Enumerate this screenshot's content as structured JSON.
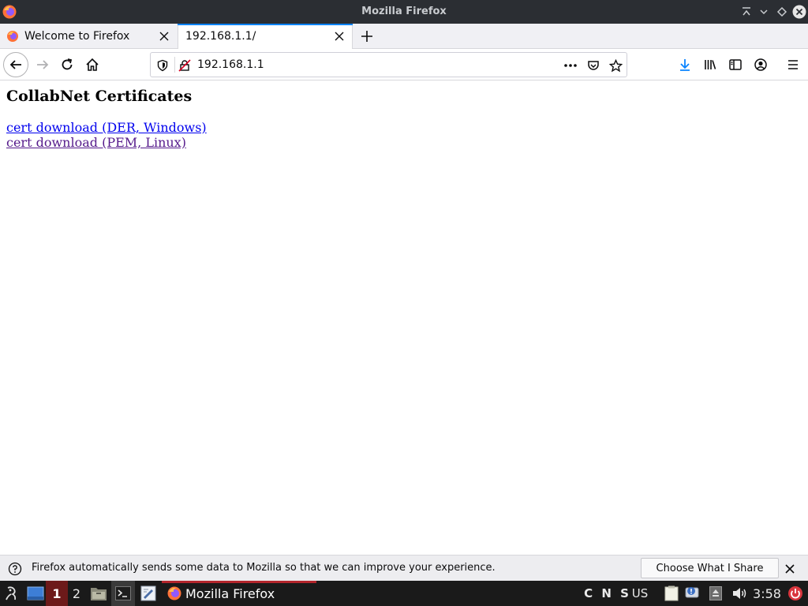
{
  "window": {
    "title": "Mozilla Firefox"
  },
  "tabs": [
    {
      "label": "Welcome to Firefox",
      "favicon": "firefox-icon"
    },
    {
      "label": "192.168.1.1/",
      "active": true
    }
  ],
  "navbar": {
    "url": "192.168.1.1"
  },
  "page": {
    "heading": "CollabNet Certificates",
    "links": [
      {
        "label": "cert download (DER, Windows)",
        "visited": false
      },
      {
        "label": "cert download (PEM, Linux)",
        "visited": true
      }
    ]
  },
  "notification": {
    "message": "Firefox automatically sends some data to Mozilla so that we can improve your experience.",
    "button_label": "Choose What I Share"
  },
  "taskbar": {
    "workspaces": [
      "1",
      "2"
    ],
    "window_label": "Mozilla Firefox",
    "keyboard_indicators": "C N S",
    "layout": "US",
    "clock": "3:58"
  },
  "colors": {
    "accent": "#0a84ff",
    "link": "#0000ee",
    "visited_link": "#551a8b",
    "titlebar": "#2b2e33",
    "taskbar": "#1a1a1a",
    "taskbar_active": "#b3262c"
  }
}
